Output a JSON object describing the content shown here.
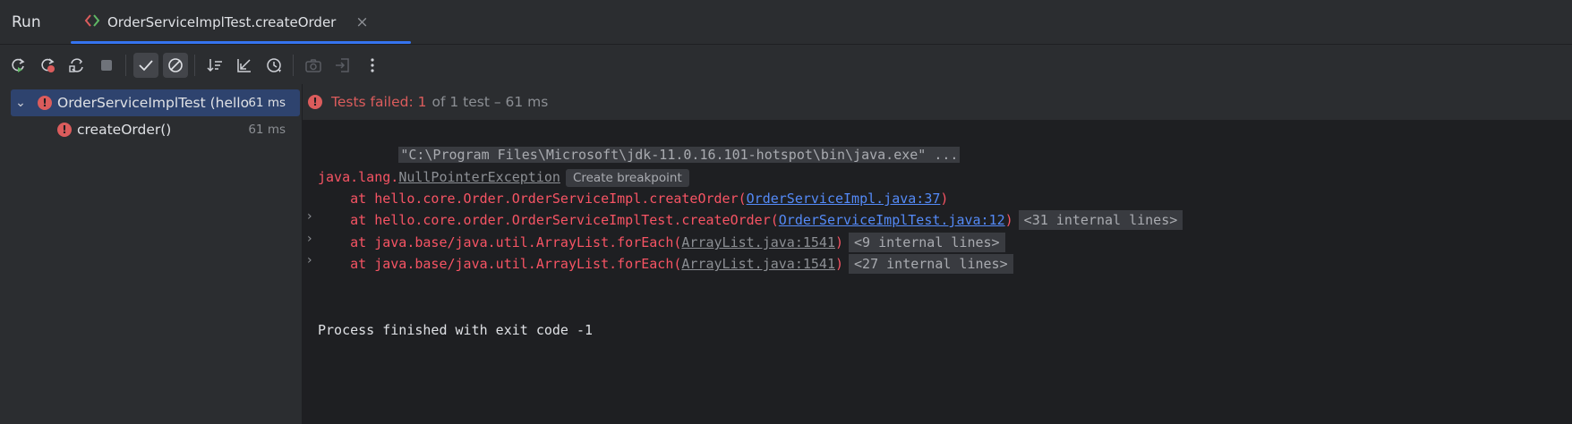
{
  "header": {
    "run_label": "Run",
    "tab_label": "OrderServiceImplTest.createOrder",
    "tab_close": "×"
  },
  "toolbar": {
    "icons": [
      "rerun-icon",
      "rerun-failed-icon",
      "toggle-auto-test-icon",
      "stop-icon",
      "show-passed-icon",
      "show-ignored-icon",
      "sort-icon",
      "collapse-icon",
      "history-icon",
      "screenshot-icon",
      "import-icon",
      "more-icon"
    ]
  },
  "tree": {
    "root": {
      "label": "OrderServiceImplTest (hello",
      "time": "61 ms"
    },
    "child": {
      "label": "createOrder()",
      "time": "61 ms"
    }
  },
  "status": {
    "failed": "Tests failed: 1",
    "rest": "of 1 test – 61 ms"
  },
  "console": {
    "cmd": "\"C:\\Program Files\\Microsoft\\jdk-11.0.16.101-hotspot\\bin\\java.exe\" ...",
    "exception_prefix": "java.lang.",
    "exception_name": "NullPointerException",
    "create_breakpoint": "Create breakpoint",
    "frames": [
      {
        "prefix": "    at hello.core.Order.OrderServiceImpl.createOrder(",
        "link": "OrderServiceImpl.java:37",
        "suffix": ")",
        "internal": ""
      },
      {
        "prefix": "    at hello.core.order.OrderServiceImplTest.createOrder(",
        "link": "OrderServiceImplTest.java:12",
        "suffix": ")",
        "internal": "<31 internal lines>"
      },
      {
        "prefix": "    at java.base/java.util.ArrayList.forEach(",
        "link": "ArrayList.java:1541",
        "suffix": ")",
        "internal": "<9 internal lines>"
      },
      {
        "prefix": "    at java.base/java.util.ArrayList.forEach(",
        "link": "ArrayList.java:1541",
        "suffix": ")",
        "internal": "<27 internal lines>"
      }
    ],
    "exit": "Process finished with exit code -1"
  },
  "colors": {
    "accent": "#3574f0",
    "error": "#db5c5c",
    "link": "#548af7",
    "selection": "#2e436e"
  }
}
